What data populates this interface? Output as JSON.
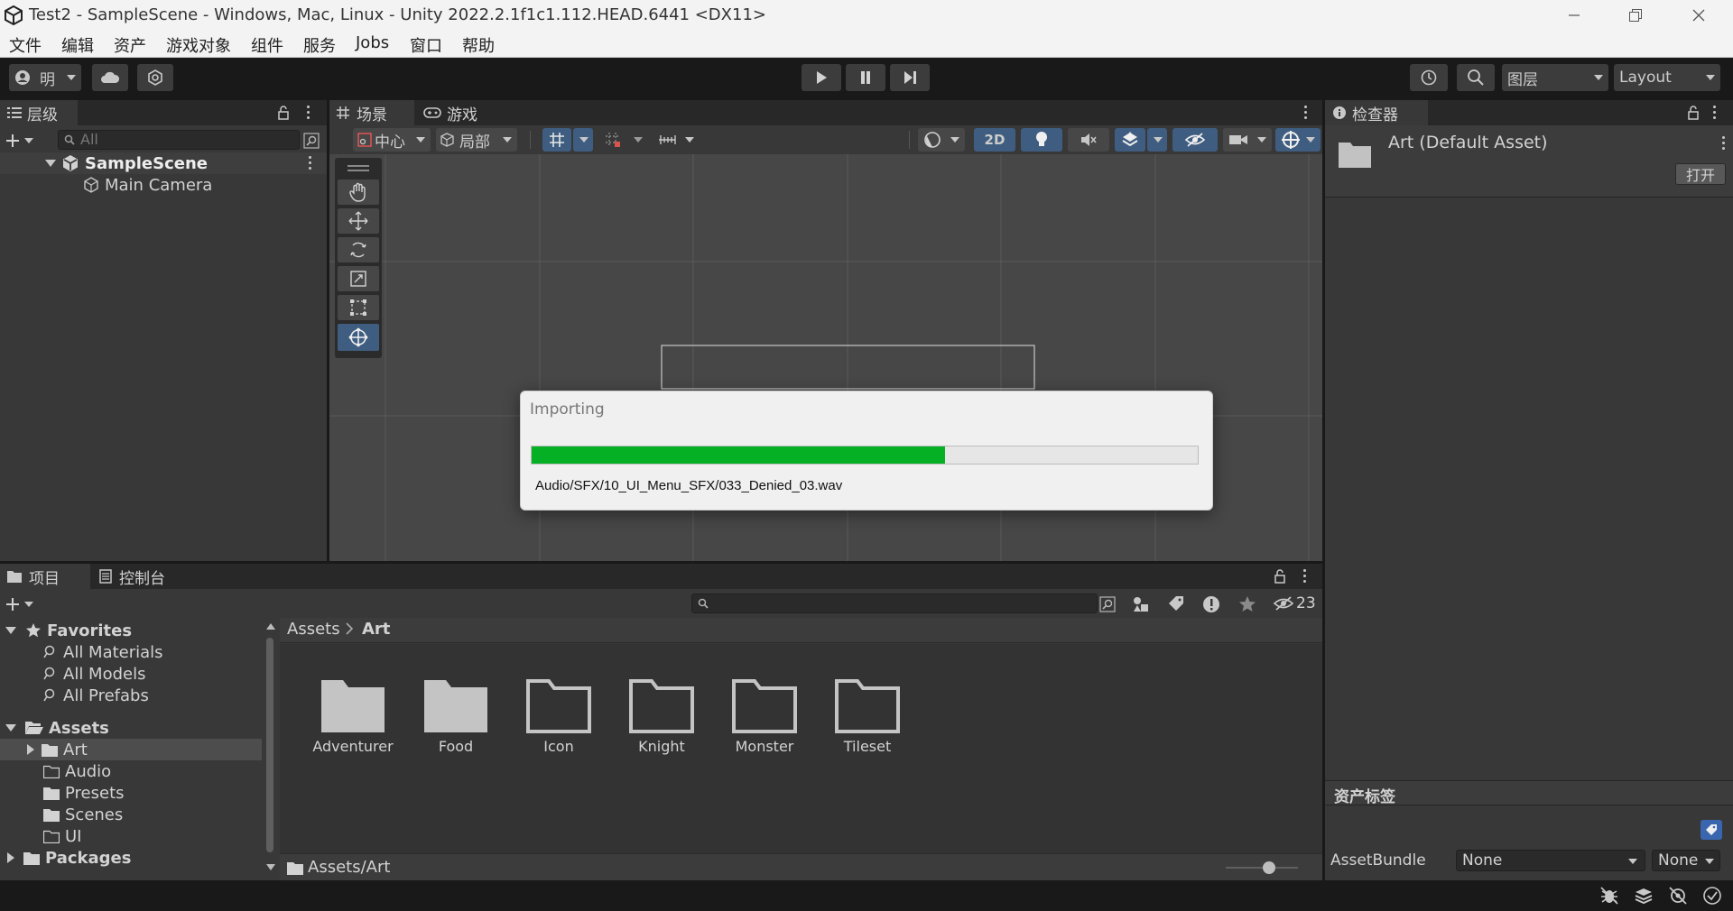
{
  "window": {
    "title": "Test2 - SampleScene - Windows, Mac, Linux - Unity 2022.2.1f1c1.112.HEAD.6441 <DX11>"
  },
  "menu": [
    "文件",
    "编辑",
    "资产",
    "游戏对象",
    "组件",
    "服务",
    "Jobs",
    "窗口",
    "帮助"
  ],
  "toolbar": {
    "account_label": "明",
    "layers_label": "图层",
    "layout_label": "Layout"
  },
  "hierarchy": {
    "tab": "层级",
    "search_placeholder": "All",
    "scene_name": "SampleScene",
    "objects": [
      "Main Camera"
    ]
  },
  "scene": {
    "tabs": [
      "场景",
      "游戏"
    ],
    "pivot_label": "中心",
    "space_label": "局部",
    "mode_2d": "2D"
  },
  "inspector": {
    "tab": "检查器",
    "asset_title": "Art (Default Asset)",
    "open_button": "打开",
    "labels_header": "资产标签",
    "assetbundle_label": "AssetBundle",
    "assetbundle_value": "None",
    "variant_value": "None"
  },
  "project": {
    "tabs": [
      "项目",
      "控制台"
    ],
    "breadcrumb": [
      "Assets",
      "Art"
    ],
    "hidden_count": "23",
    "tree": {
      "favorites": "Favorites",
      "favorite_items": [
        "All Materials",
        "All Models",
        "All Prefabs"
      ],
      "assets": "Assets",
      "asset_folders": [
        "Art",
        "Audio",
        "Presets",
        "Scenes",
        "UI"
      ],
      "packages": "Packages"
    },
    "items": [
      {
        "name": "Adventurer",
        "filled": true
      },
      {
        "name": "Food",
        "filled": true
      },
      {
        "name": "Icon",
        "filled": false
      },
      {
        "name": "Knight",
        "filled": false
      },
      {
        "name": "Monster",
        "filled": false
      },
      {
        "name": "Tileset",
        "filled": false
      }
    ],
    "footer_path": "Assets/Art",
    "zoom_level": 0.6
  },
  "dialog": {
    "title": "Importing",
    "progress": 0.62,
    "file": "Audio/SFX/10_UI_Menu_SFX/033_Denied_03.wav"
  },
  "colors": {
    "progress_fill": "#06b025",
    "selection": "#4d4d4d",
    "active_tool": "#3e5d80"
  }
}
